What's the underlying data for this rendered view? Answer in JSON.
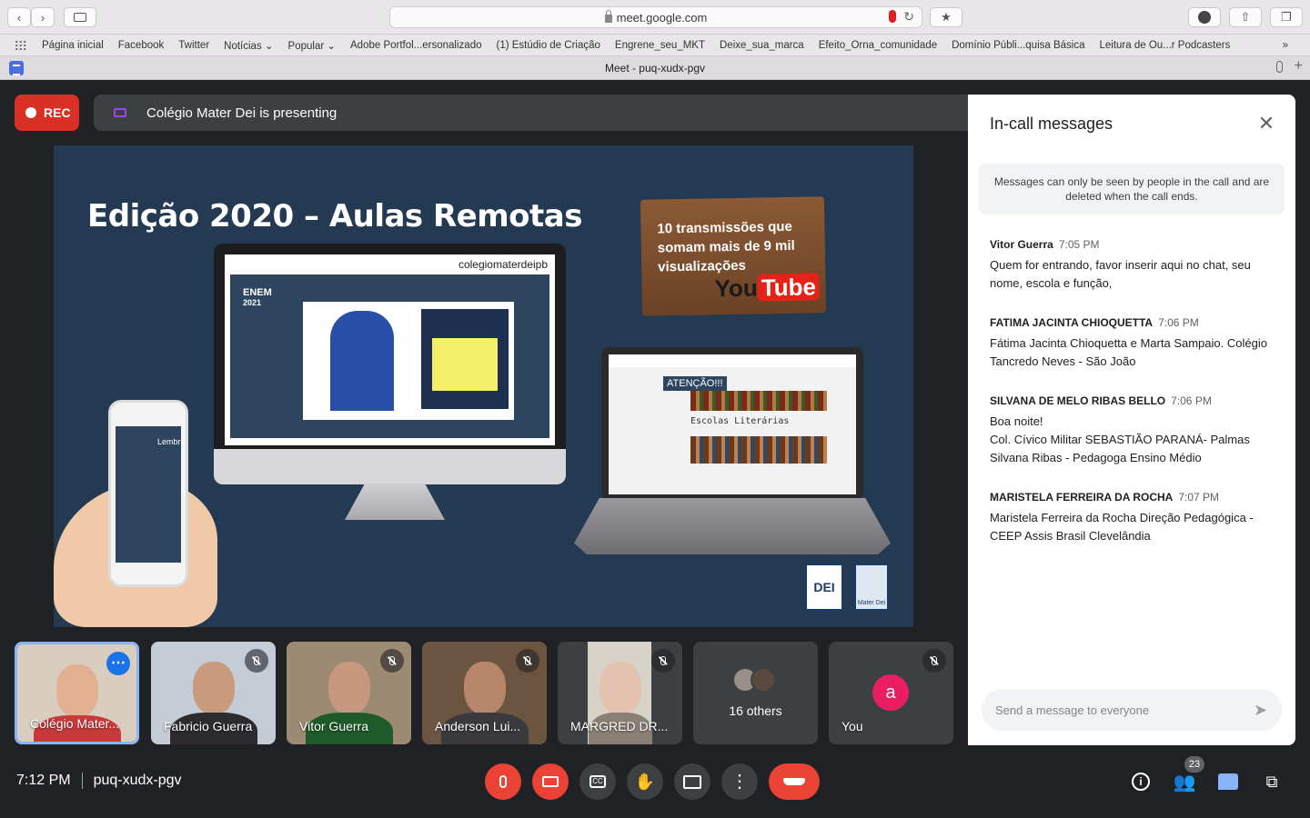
{
  "browser": {
    "url": "meet.google.com",
    "tab_title": "Meet - puq-xudx-pgv",
    "bookmarks": [
      "Página inicial",
      "Facebook",
      "Twitter",
      "Notícias ⌄",
      "Popular ⌄",
      "Adobe Portfol...ersonalizado",
      "(1) Estúdio de Criação",
      "Engrene_seu_MKT",
      "Deixe_sua_marca",
      "Efeito_Orna_comunidade",
      "Domínio Públi...quisa Básica",
      "Leitura de Ou...r Podcasters"
    ],
    "bookmarks_more": "»",
    "icons": {
      "back": "chevron-left-icon",
      "forward": "chevron-right-icon",
      "sidebar": "sidebar-icon",
      "download": "download-icon",
      "share": "share-icon",
      "tabs": "tabs-icon"
    }
  },
  "meet": {
    "rec_label": "REC",
    "presenting_text": "Colégio Mater Dei is presenting",
    "slide": {
      "title": "Edição 2020 – Aulas Remotas",
      "sign_text": "10 transmissões que somam mais de 9 mil visualizações",
      "youtube_you": "You",
      "youtube_tube": "Tube",
      "monitor_channel": "colegiomaterdeipb",
      "monitor_logo": "ENEM",
      "monitor_year": "2021",
      "laptop_heading": "ATENÇÃO!!!",
      "laptop_caption": "Escolas Literárias",
      "phone_label": "Lembra",
      "logo_dei": "DEI",
      "logo_mater": "Mater Dei"
    },
    "tiles": [
      {
        "name": "Colégio Mater..."
      },
      {
        "name": "Fabricio Guerra"
      },
      {
        "name": "Vitor Guerra"
      },
      {
        "name": "Anderson Lui..."
      },
      {
        "name": "MARGRED DR..."
      },
      {
        "name": "16 others"
      },
      {
        "name": "You",
        "initial": "a"
      }
    ],
    "bottom": {
      "time": "7:12 PM",
      "meeting_code": "puq-xudx-pgv",
      "participants_count": "23"
    },
    "colors": {
      "accent": "#1a73e8",
      "danger": "#ea4335",
      "avatar": "#e91e63"
    }
  },
  "chat": {
    "title": "In-call messages",
    "note": "Messages can only be seen by people in the call and are deleted when the call ends.",
    "input_placeholder": "Send a message to everyone",
    "messages": [
      {
        "sender": "Vitor Guerra",
        "time": "7:05 PM",
        "lines": [
          "Quem for entrando, favor inserir aqui no chat, seu",
          "nome, escola e função,"
        ]
      },
      {
        "sender": "FATIMA JACINTA CHIOQUETTA",
        "time": "7:06 PM",
        "lines": [
          "Fátima Jacinta Chioquetta e Marta Sampaio. Colégio",
          "Tancredo Neves - São João"
        ]
      },
      {
        "sender": "SILVANA DE MELO RIBAS BELLO",
        "time": "7:06 PM",
        "lines": [
          "Boa noite!",
          "Col. Cívico Militar SEBASTIÃO PARANÁ- Palmas",
          "Silvana Ribas - Pedagoga Ensino Médio"
        ]
      },
      {
        "sender": "MARISTELA FERREIRA DA ROCHA",
        "time": "7:07 PM",
        "lines": [
          "Maristela Ferreira da Rocha Direção Pedagógica -",
          "CEEP Assis Brasil Clevelândia"
        ]
      }
    ]
  }
}
